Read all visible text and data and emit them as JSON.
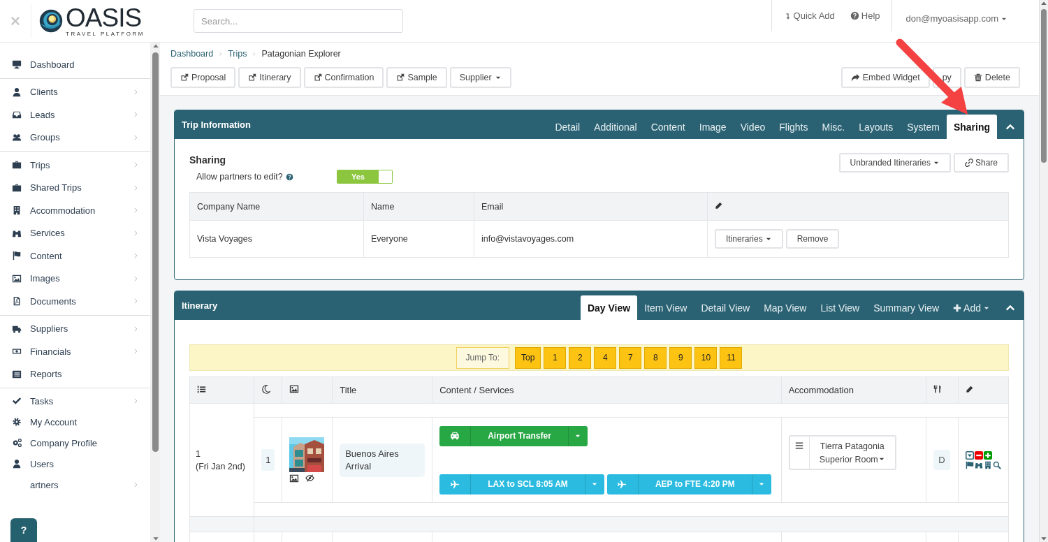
{
  "header": {
    "logo": {
      "name": "OASIS",
      "tagline": "TRAVEL PLATFORM"
    },
    "search": {
      "placeholder": "Search..."
    },
    "quick_add": "Quick Add",
    "help": "Help",
    "user": "don@myoasisapp.com"
  },
  "sidebar": {
    "groups": [
      [
        {
          "label": "Dashboard",
          "has_submenu": false
        }
      ],
      [
        {
          "label": "Clients",
          "has_submenu": true
        },
        {
          "label": "Leads",
          "has_submenu": true
        },
        {
          "label": "Groups",
          "has_submenu": true
        }
      ],
      [
        {
          "label": "Trips",
          "has_submenu": true
        },
        {
          "label": "Shared Trips",
          "has_submenu": true
        },
        {
          "label": "Accommodation",
          "has_submenu": true
        },
        {
          "label": "Services",
          "has_submenu": true
        },
        {
          "label": "Content",
          "has_submenu": true
        },
        {
          "label": "Images",
          "has_submenu": true
        },
        {
          "label": "Documents",
          "has_submenu": true
        }
      ],
      [
        {
          "label": "Suppliers",
          "has_submenu": true
        },
        {
          "label": "Financials",
          "has_submenu": true
        },
        {
          "label": "Reports",
          "has_submenu": false
        }
      ],
      [
        {
          "label": "Tasks",
          "has_submenu": true
        },
        {
          "label": "My Account",
          "has_submenu": false
        },
        {
          "label": "Company Profile",
          "has_submenu": false
        },
        {
          "label": "Users",
          "has_submenu": false
        },
        {
          "label": "artners",
          "has_submenu": true
        }
      ]
    ],
    "help_button": "?"
  },
  "breadcrumb": [
    "Dashboard",
    "Trips",
    "Patagonian Explorer"
  ],
  "toolbar": {
    "left": [
      {
        "label": "Proposal",
        "kind": "external"
      },
      {
        "label": "Itinerary",
        "kind": "external"
      },
      {
        "label": "Confirmation",
        "kind": "external"
      },
      {
        "label": "Sample",
        "kind": "external"
      },
      {
        "label": "Supplier",
        "kind": "dropdown"
      }
    ],
    "right": [
      {
        "label": "Embed Widget",
        "kind": "share"
      },
      {
        "label": "py",
        "kind": "copy"
      },
      {
        "label": "Delete",
        "kind": "trash"
      }
    ]
  },
  "trip_info": {
    "title": "Trip Information",
    "tabs": [
      {
        "label": "Detail",
        "selected": false
      },
      {
        "label": "Additional",
        "selected": false
      },
      {
        "label": "Content",
        "selected": false
      },
      {
        "label": "Image",
        "selected": false
      },
      {
        "label": "Video",
        "selected": false
      },
      {
        "label": "Flights",
        "selected": false
      },
      {
        "label": "Misc.",
        "selected": false
      },
      {
        "label": "Layouts",
        "selected": false
      },
      {
        "label": "System",
        "selected": false
      },
      {
        "label": "Sharing",
        "selected": true
      }
    ],
    "section_title": "Sharing",
    "allow_edit": {
      "label": "Allow partners to edit?",
      "on": true,
      "on_text": "Yes"
    },
    "actions": [
      {
        "label": "Unbranded Itineraries",
        "kind": "dropdown"
      },
      {
        "label": "Share",
        "kind": "link"
      }
    ],
    "table": {
      "columns": [
        "Company Name",
        "Name",
        "Email"
      ],
      "rows": [
        {
          "cells": [
            "Vista Voyages",
            "Everyone",
            "info@vistavoyages.com"
          ],
          "actions": [
            {
              "label": "Itineraries",
              "kind": "dropdown"
            },
            {
              "label": "Remove",
              "kind": "plain"
            }
          ]
        }
      ]
    }
  },
  "itinerary": {
    "title": "Itinerary",
    "tabs": [
      {
        "label": "Day View",
        "selected": true
      },
      {
        "label": "Item View",
        "selected": false
      },
      {
        "label": "Detail View",
        "selected": false
      },
      {
        "label": "Map View",
        "selected": false
      },
      {
        "label": "List View",
        "selected": false
      },
      {
        "label": "Summary View",
        "selected": false
      }
    ],
    "add": "Add",
    "jump": {
      "label": "Jump To:",
      "targets": [
        "Top",
        "1",
        "2",
        "4",
        "7",
        "8",
        "9",
        "10",
        "11"
      ]
    },
    "columns": [
      "Title",
      "Content / Services",
      "Accommodation"
    ],
    "days": [
      {
        "day": "1",
        "date": "(Fri Jan 2nd)",
        "nights": "1",
        "title": "Buenos Aires Arrival",
        "services": [
          {
            "label": "Airport Transfer",
            "kind": "transfer"
          },
          {
            "label": "LAX to SCL 8:05 AM",
            "kind": "flight"
          },
          {
            "label": "AEP to FTE 4:20 PM",
            "kind": "flight"
          }
        ],
        "accommodation": {
          "name": "Tierra Patagonia",
          "room": "Superior Room"
        },
        "meals": "D"
      }
    ]
  }
}
